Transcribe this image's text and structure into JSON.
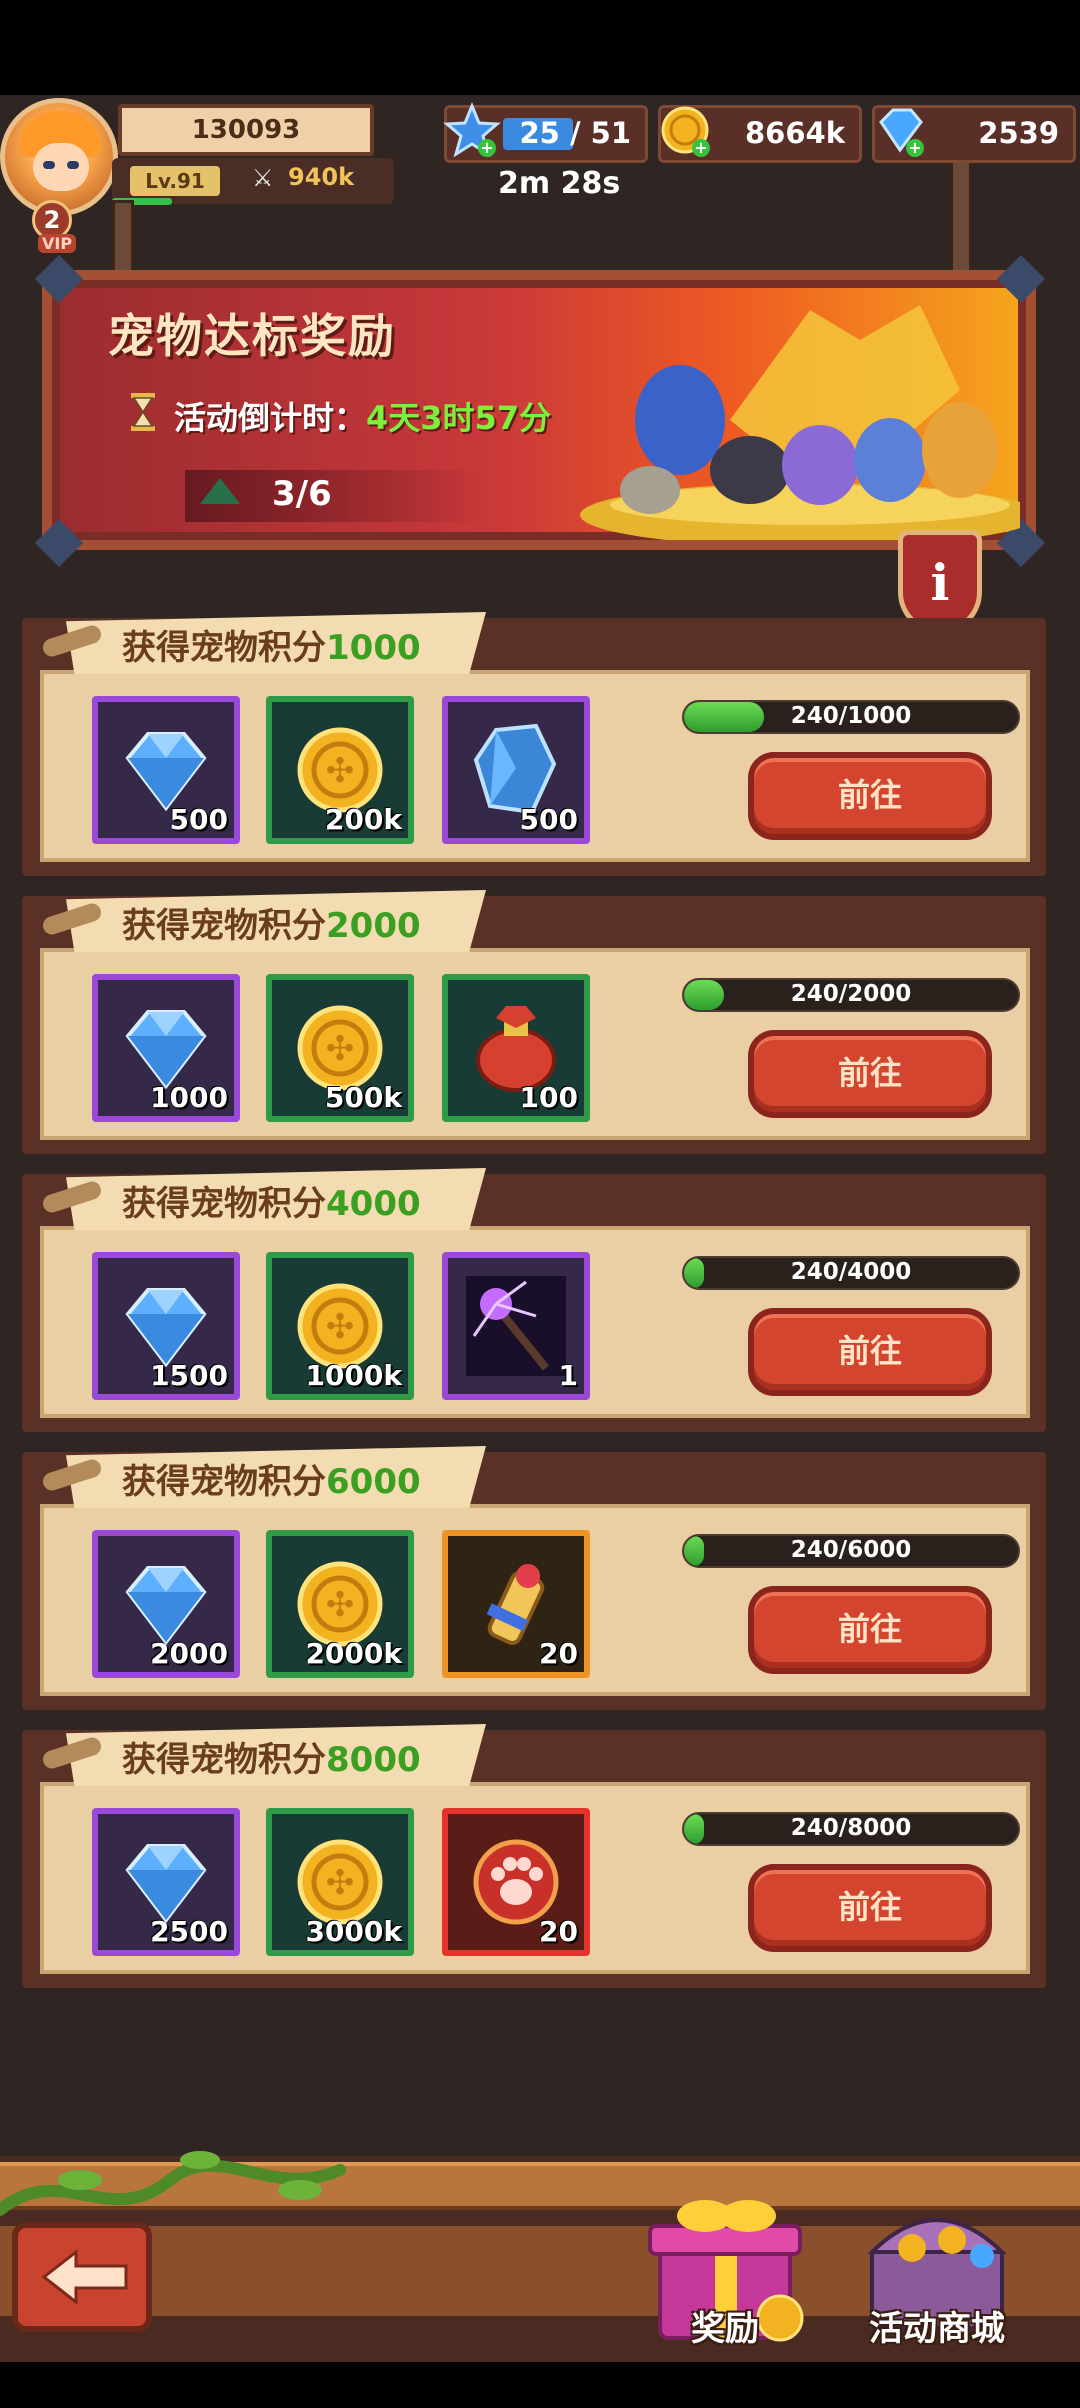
{
  "header": {
    "player_id": "130093",
    "level": "Lv.91",
    "power": "940k",
    "vip_level": "2",
    "vip_label": "VIP",
    "stamina": "25 / 51",
    "stamina_timer": "2m 28s",
    "gold": "8664k",
    "gems": "2539"
  },
  "banner": {
    "title": "宠物达标奖励",
    "countdown_label": "活动倒计时：",
    "countdown_value": "4天3时57分",
    "progress": "3/6",
    "info_icon": "i"
  },
  "rewards": [
    {
      "title_prefix": "获得宠物积分",
      "target": "1000",
      "progress_text": "240/1000",
      "progress_fraction": 0.24,
      "go_label": "前往",
      "items": [
        {
          "icon": "gem-icon",
          "qty": "500",
          "rarity": "purple"
        },
        {
          "icon": "gold-coin-icon",
          "qty": "200k",
          "rarity": "green"
        },
        {
          "icon": "crystal-shard-icon",
          "qty": "500",
          "rarity": "purple"
        }
      ]
    },
    {
      "title_prefix": "获得宠物积分",
      "target": "2000",
      "progress_text": "240/2000",
      "progress_fraction": 0.12,
      "go_label": "前往",
      "items": [
        {
          "icon": "gem-icon",
          "qty": "1000",
          "rarity": "purple"
        },
        {
          "icon": "gold-coin-icon",
          "qty": "500k",
          "rarity": "green"
        },
        {
          "icon": "lucky-bag-icon",
          "qty": "100",
          "rarity": "green"
        }
      ]
    },
    {
      "title_prefix": "获得宠物积分",
      "target": "4000",
      "progress_text": "240/4000",
      "progress_fraction": 0.06,
      "go_label": "前往",
      "items": [
        {
          "icon": "gem-icon",
          "qty": "1500",
          "rarity": "purple"
        },
        {
          "icon": "gold-coin-icon",
          "qty": "1000k",
          "rarity": "green"
        },
        {
          "icon": "lightning-staff-icon",
          "qty": "1",
          "rarity": "purple"
        }
      ]
    },
    {
      "title_prefix": "获得宠物积分",
      "target": "6000",
      "progress_text": "240/6000",
      "progress_fraction": 0.04,
      "go_label": "前往",
      "items": [
        {
          "icon": "gem-icon",
          "qty": "2000",
          "rarity": "purple"
        },
        {
          "icon": "gold-coin-icon",
          "qty": "2000k",
          "rarity": "green"
        },
        {
          "icon": "scroll-icon",
          "qty": "20",
          "rarity": "orange"
        }
      ]
    },
    {
      "title_prefix": "获得宠物积分",
      "target": "8000",
      "progress_text": "240/8000",
      "progress_fraction": 0.03,
      "go_label": "前往",
      "items": [
        {
          "icon": "gem-icon",
          "qty": "2500",
          "rarity": "purple"
        },
        {
          "icon": "gold-coin-icon",
          "qty": "3000k",
          "rarity": "green"
        },
        {
          "icon": "paw-token-icon",
          "qty": "20",
          "rarity": "red"
        }
      ]
    }
  ],
  "nav": {
    "rewards_label": "奖励",
    "shop_label": "活动商城"
  },
  "colors": {
    "accent_green": "#3b9f21",
    "button_red": "#d4452f",
    "panel_tan": "#e9cfa3"
  }
}
